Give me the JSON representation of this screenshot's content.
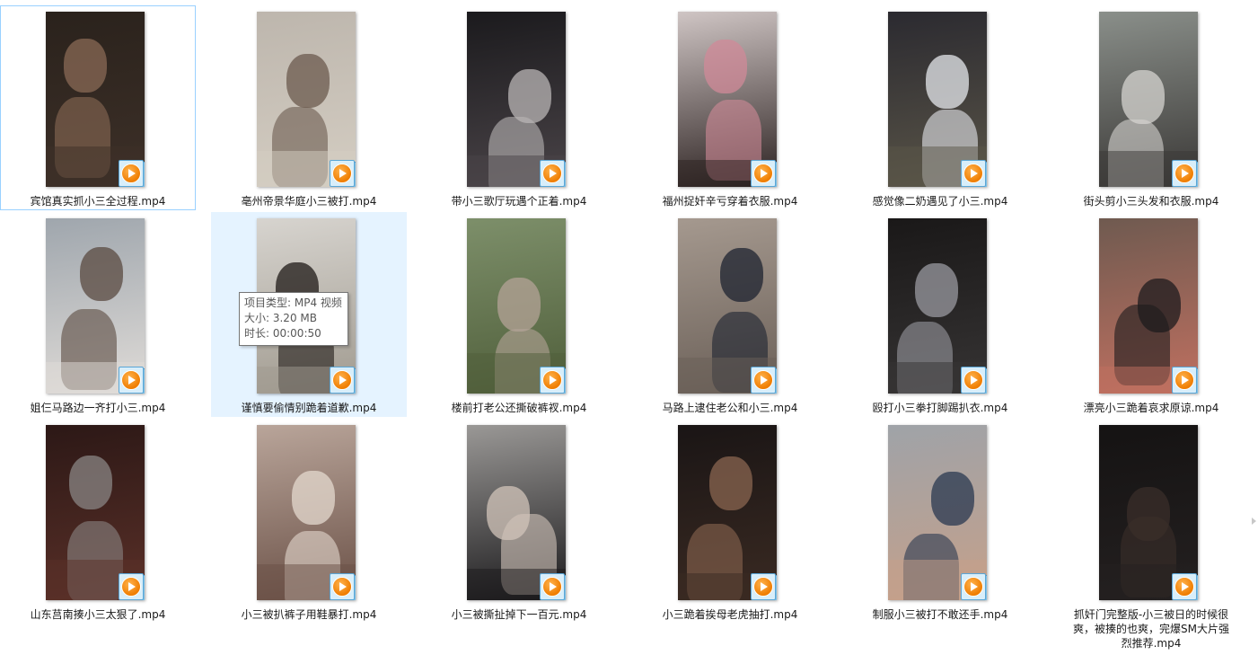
{
  "files": [
    {
      "name": "宾馆真实抓小三全过程.mp4",
      "colors": [
        "#2a221c",
        "#8a6a55",
        "#3d3028"
      ],
      "state": "focused"
    },
    {
      "name": "亳州帝景华庭小三被打.mp4",
      "colors": [
        "#bdb6ad",
        "#6b5a4e",
        "#d4cdc2"
      ],
      "state": ""
    },
    {
      "name": "带小三歌厅玩遇个正着.mp4",
      "colors": [
        "#1b1a1d",
        "#b9b5b6",
        "#4a4448"
      ],
      "state": ""
    },
    {
      "name": "福州捉奸辛亏穿着衣服.mp4",
      "colors": [
        "#cfc5c4",
        "#d08a98",
        "#2b2120"
      ],
      "state": ""
    },
    {
      "name": "感觉像二奶遇见了小三.mp4",
      "colors": [
        "#2b2a30",
        "#e6e8ec",
        "#5a5548"
      ],
      "state": ""
    },
    {
      "name": "街头剪小三头发和衣服.mp4",
      "colors": [
        "#8a8f8a",
        "#d6d4d0",
        "#3a3836"
      ],
      "state": ""
    },
    {
      "name": "姐仨马路边一齐打小三.mp4",
      "colors": [
        "#9fa6ad",
        "#5a4a40",
        "#e0dcd8"
      ],
      "state": ""
    },
    {
      "name": "谨慎要偷情别跪着道歉.mp4",
      "colors": [
        "#d7d4cf",
        "#1f1a17",
        "#a09a8f"
      ],
      "state": "hovered"
    },
    {
      "name": "楼前打老公还撕破裤衩.mp4",
      "colors": [
        "#7d8f6a",
        "#b4a397",
        "#4f5e3a"
      ],
      "state": ""
    },
    {
      "name": "马路上逮住老公和小三.mp4",
      "colors": [
        "#a5998f",
        "#1d2330",
        "#6a5f57"
      ],
      "state": ""
    },
    {
      "name": "殴打小三拳打脚踢扒衣.mp4",
      "colors": [
        "#1a1818",
        "#9a9aa0",
        "#363434"
      ],
      "state": ""
    },
    {
      "name": "漂亮小三跪着哀求原谅.mp4",
      "colors": [
        "#6f5a50",
        "#1d1b1d",
        "#c07060"
      ],
      "state": ""
    },
    {
      "name": "山东莒南揍小三太狠了.mp4",
      "colors": [
        "#2c1816",
        "#8a8584",
        "#5a3028"
      ],
      "state": ""
    },
    {
      "name": "小三被扒裤子用鞋暴打.mp4",
      "colors": [
        "#b9a59a",
        "#e4d9cf",
        "#6a5046"
      ],
      "state": ""
    },
    {
      "name": "小三被撕扯掉下一百元.mp4",
      "colors": [
        "#9a9896",
        "#d2c4ba",
        "#1b1a1c"
      ],
      "state": ""
    },
    {
      "name": "小三跪着挨母老虎抽打.mp4",
      "colors": [
        "#1a1515",
        "#8a6550",
        "#3a2a22"
      ],
      "state": ""
    },
    {
      "name": "制服小三被打不敢还手.mp4",
      "colors": [
        "#9fa3a8",
        "#2a3850",
        "#c5a08a"
      ],
      "state": ""
    },
    {
      "name": "抓奸门完整版-小三被日的时候很爽，被揍的也爽，完爆SM大片强烈推荐.mp4",
      "colors": [
        "#151313",
        "#3a2e2a",
        "#242020"
      ],
      "state": "",
      "multiline": true
    }
  ],
  "tooltip": {
    "type_line": "项目类型: MP4 视频",
    "size_line": "大小: 3.20 MB",
    "duration_line": "时长: 00:00:50"
  }
}
